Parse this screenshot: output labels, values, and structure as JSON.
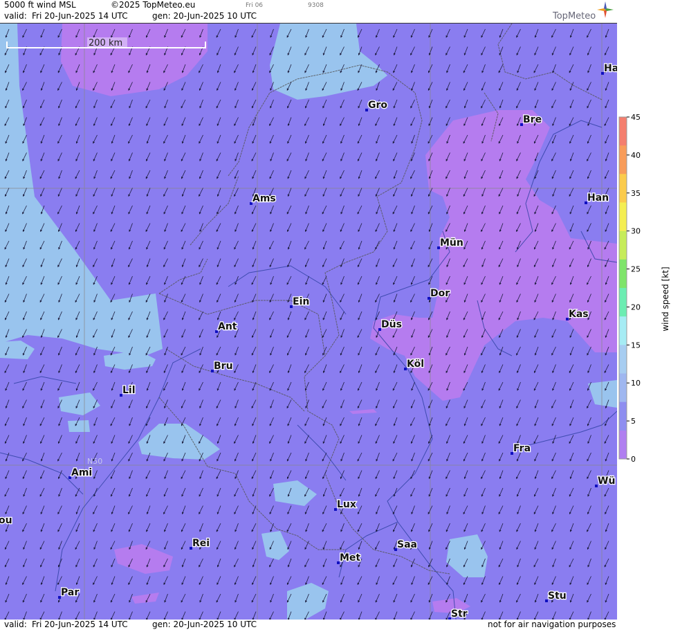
{
  "header": {
    "product": "5000 ft wind MSL",
    "copyright": "©2025 TopMeteo.eu",
    "run_tag": "Fri 06",
    "code": "9308",
    "valid_prefix": "valid:",
    "valid": "Fri  20-Jun-2025  14 UTC",
    "gen": "gen: 20-Jun-2025 10 UTC",
    "logo": "TopMeteo"
  },
  "footer": {
    "valid_prefix": "valid:",
    "valid": "Fri  20-Jun-2025  14 UTC",
    "gen": "gen: 20-Jun-2025 10 UTC",
    "disclaimer": "not for air navigation purposes"
  },
  "map": {
    "scale_label": "200 km",
    "lat_label": "N50",
    "wind_direction_from": "NE",
    "colors": {
      "light_blue": "#99c4ee",
      "blue_violet": "#8a7df0",
      "violet": "#b57cef"
    },
    "cities": [
      {
        "name": "Gro"
      },
      {
        "name": "Ha"
      },
      {
        "name": "Bre"
      },
      {
        "name": "Ams"
      },
      {
        "name": "Han"
      },
      {
        "name": "Mün"
      },
      {
        "name": "Dor"
      },
      {
        "name": "Ein"
      },
      {
        "name": "Kas"
      },
      {
        "name": "Ant"
      },
      {
        "name": "Düs"
      },
      {
        "name": "Köl"
      },
      {
        "name": "Bru"
      },
      {
        "name": "Lil"
      },
      {
        "name": "Fra"
      },
      {
        "name": "Ami"
      },
      {
        "name": "Wü"
      },
      {
        "name": "ou"
      },
      {
        "name": "Lux"
      },
      {
        "name": "Rei"
      },
      {
        "name": "Saa"
      },
      {
        "name": "Met"
      },
      {
        "name": "Par"
      },
      {
        "name": "Stu"
      },
      {
        "name": "Str"
      }
    ]
  },
  "legend": {
    "title": "wind  speed  [kt]",
    "ticks": [
      "45",
      "40",
      "35",
      "30",
      "25",
      "20",
      "15",
      "10",
      "5",
      "0"
    ],
    "colors": [
      "#f47e6e",
      "#f89c5a",
      "#fbcb4c",
      "#f4ee52",
      "#c6ec5a",
      "#7ee46a",
      "#6cedb2",
      "#a6ecf4",
      "#a7cdf1",
      "#9fb7f0",
      "#8e8ef0",
      "#b07ff0"
    ]
  }
}
